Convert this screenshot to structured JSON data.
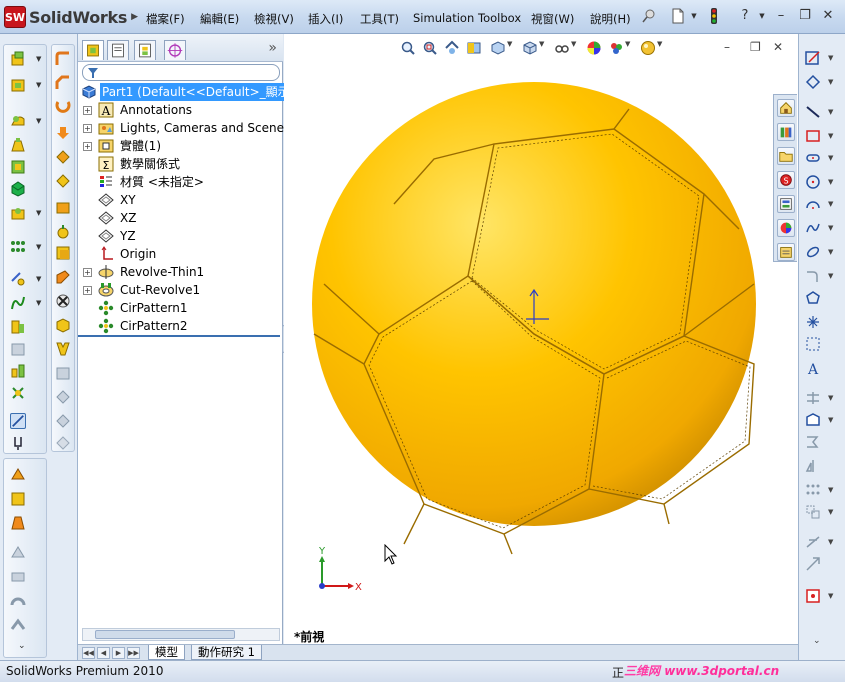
{
  "app": {
    "logo_text": "SolidWorks",
    "logo_mark": "SW"
  },
  "menu": [
    "檔案(F)",
    "編輯(E)",
    "檢視(V)",
    "插入(I)",
    "工具(T)",
    "Simulation",
    "Toolbox",
    "視窗(W)",
    "說明(H)"
  ],
  "help_symbol": "?",
  "window_controls": {
    "minimize": "–",
    "restore": "❐",
    "close": "✕"
  },
  "feature_tree": {
    "expand_symbol": "»",
    "root": "Part1  (Default<<Default>_顯示",
    "items": [
      {
        "label": "Annotations",
        "icon": "annotations-icon",
        "expandable": true
      },
      {
        "label": "Lights, Cameras and Scene",
        "icon": "lights-cameras-icon",
        "expandable": true
      },
      {
        "label": "實體(1)",
        "icon": "solid-bodies-icon",
        "expandable": true
      },
      {
        "label": "數學關係式",
        "icon": "equations-icon",
        "expandable": false
      },
      {
        "label": "材質 <未指定>",
        "icon": "material-icon",
        "expandable": false
      },
      {
        "label": "XY",
        "icon": "plane-icon",
        "expandable": false
      },
      {
        "label": "XZ",
        "icon": "plane-icon",
        "expandable": false
      },
      {
        "label": "YZ",
        "icon": "plane-icon",
        "expandable": false
      },
      {
        "label": "Origin",
        "icon": "origin-icon",
        "expandable": false
      },
      {
        "label": "Revolve-Thin1",
        "icon": "revolve-icon",
        "expandable": true
      },
      {
        "label": "Cut-Revolve1",
        "icon": "cut-revolve-icon",
        "expandable": true
      },
      {
        "label": "CirPattern1",
        "icon": "circular-pattern-icon",
        "expandable": false
      },
      {
        "label": "CirPattern2",
        "icon": "circular-pattern-icon",
        "expandable": false
      }
    ]
  },
  "bottom_tabs": [
    "模型",
    "動作研究 1"
  ],
  "viewport": {
    "view_name": "*前視",
    "triad_x": "X",
    "triad_y": "Y",
    "part_color": "#f5b800"
  },
  "status": {
    "product": "SolidWorks Premium 2010",
    "mode": "正"
  },
  "watermark": {
    "cn": "三维网",
    "url": "www.3dportal.cn"
  },
  "colors": {
    "selection": "#3399ff",
    "frame": "#dfe8f3"
  }
}
